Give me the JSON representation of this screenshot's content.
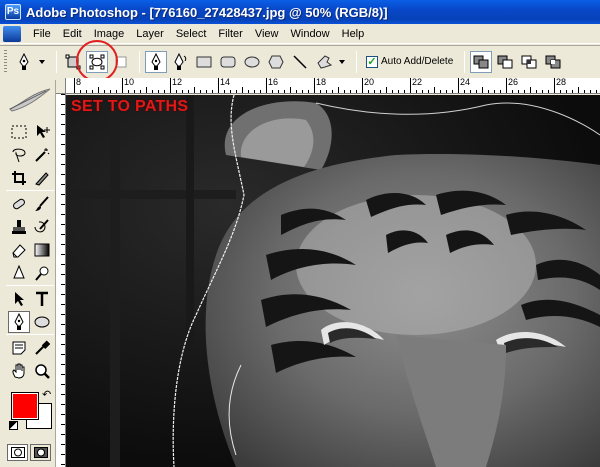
{
  "window": {
    "title": "Adobe Photoshop - [776160_27428437.jpg @ 50% (RGB/8)]"
  },
  "menu": {
    "items": [
      "File",
      "Edit",
      "Image",
      "Layer",
      "Select",
      "Filter",
      "View",
      "Window",
      "Help"
    ]
  },
  "options_bar": {
    "auto_add_delete_label": "Auto Add/Delete",
    "auto_add_delete_checked": true,
    "selected_mode": "paths",
    "annotation_color": "#e02020"
  },
  "ruler": {
    "top_labels": [
      "8",
      "10",
      "12",
      "14",
      "16",
      "18",
      "20",
      "22",
      "24",
      "26",
      "28"
    ]
  },
  "toolbox": {
    "active_tool": "pen-tool",
    "foreground_color": "#ff0000",
    "background_color": "#ffffff"
  },
  "canvas": {
    "annotation_text": "SET TO PATHS",
    "annotation_color": "#e01818"
  }
}
